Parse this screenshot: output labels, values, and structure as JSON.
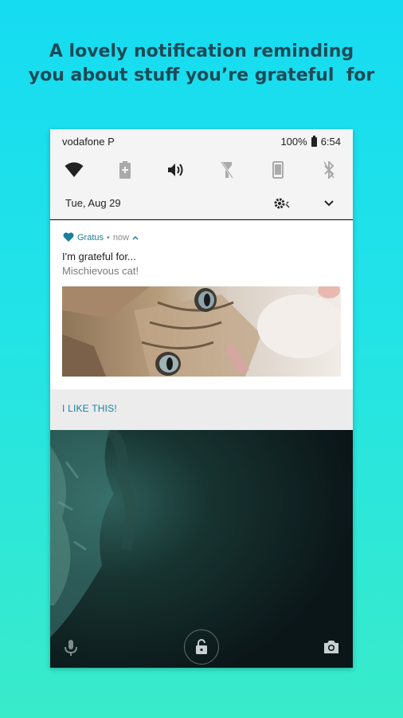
{
  "headline": {
    "line1": "A lovely notification reminding",
    "line2": "you about stuff you’re grateful  for"
  },
  "status_bar": {
    "carrier": "vodafone P",
    "battery": "100%",
    "time": "6:54"
  },
  "quick_settings": [
    {
      "icon": "wifi-icon",
      "active": true
    },
    {
      "icon": "battery-saver-icon",
      "active": false
    },
    {
      "icon": "volume-icon",
      "active": true
    },
    {
      "icon": "flashlight-icon",
      "active": false
    },
    {
      "icon": "rotation-lock-icon",
      "active": false
    },
    {
      "icon": "bluetooth-icon",
      "active": false
    }
  ],
  "shade_footer": {
    "date": "Tue, Aug 29"
  },
  "notification": {
    "app_name": "Gratus",
    "separator": "•",
    "time": "now",
    "title": "I'm grateful for...",
    "text": "Mischievous cat!",
    "action_label": "I LIKE THIS!"
  },
  "colors": {
    "accent": "#1a7f9a",
    "headline": "#1f4a57",
    "background_top": "#16dcf2",
    "background_bottom": "#39ebc9"
  }
}
